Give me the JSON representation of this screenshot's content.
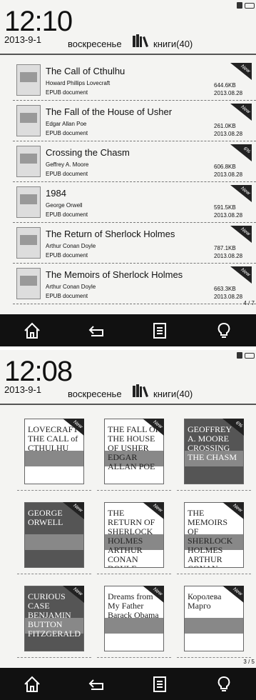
{
  "screen_list": {
    "header": {
      "time": "12:10",
      "date": "2013-9-1",
      "day": "воскресенье",
      "books": "книги(40)"
    },
    "books": [
      {
        "title": "The Call of Cthulhu",
        "author": "Howard Phillips Lovecraft",
        "type": "EPUB document",
        "size": "644.6KB",
        "date": "2013.08.28",
        "badge": "New"
      },
      {
        "title": "The Fall of the House of Usher",
        "author": "Edgar Allan Poe",
        "type": "EPUB document",
        "size": "261.0KB",
        "date": "2013.08.28",
        "badge": "New"
      },
      {
        "title": "Crossing the Chasm",
        "author": "Geffrey A. Moore",
        "type": "EPUB document",
        "size": "606.8KB",
        "date": "2013.08.28",
        "badge": "6%"
      },
      {
        "title": "1984",
        "author": "George Orwell",
        "type": "EPUB document",
        "size": "591.5KB",
        "date": "2013.08.28",
        "badge": "New"
      },
      {
        "title": "The Return of Sherlock Holmes",
        "author": "Arthur Conan Doyle",
        "type": "EPUB document",
        "size": "787.1KB",
        "date": "2013.08.28",
        "badge": "New"
      },
      {
        "title": "The Memoirs of Sherlock Holmes",
        "author": "Arthur Conan Doyle",
        "type": "EPUB document",
        "size": "663.3KB",
        "date": "2013.08.28",
        "badge": "New"
      }
    ],
    "pager": "4 / 7"
  },
  "screen_grid": {
    "header": {
      "time": "12:08",
      "date": "2013-9-1",
      "day": "воскресенье",
      "books": "книги(40)"
    },
    "covers": [
      {
        "text": "LOVECRAFT THE CALL of CTHULHU",
        "badge": "New",
        "dark": false
      },
      {
        "text": "THE FALL OF THE HOUSE OF USHER EDGAR ALLAN POE",
        "badge": "New",
        "dark": false
      },
      {
        "text": "GEOFFREY A. MOORE CROSSING THE CHASM",
        "badge": "6%",
        "dark": true
      },
      {
        "text": "GEORGE ORWELL",
        "badge": "New",
        "dark": true
      },
      {
        "text": "THE RETURN OF SHERLOCK HOLMES ARTHUR CONAN DOYLE",
        "badge": "New",
        "dark": false
      },
      {
        "text": "THE MEMOIRS OF SHERLOCK HOLMES ARTHUR CONAN DOYLE",
        "badge": "New",
        "dark": false
      },
      {
        "text": "CURIOUS CASE BENJAMIN BUTTON FITZGERALD",
        "badge": "New",
        "dark": true
      },
      {
        "text": "Dreams from My Father Barack Obama",
        "badge": "New",
        "dark": false
      },
      {
        "text": "Королева Марго",
        "badge": "New",
        "dark": false
      }
    ],
    "pager": "3 / 5"
  },
  "icons": {
    "home": "home-icon",
    "back": "back-icon",
    "menu": "menu-icon",
    "light": "lightbulb-icon"
  }
}
